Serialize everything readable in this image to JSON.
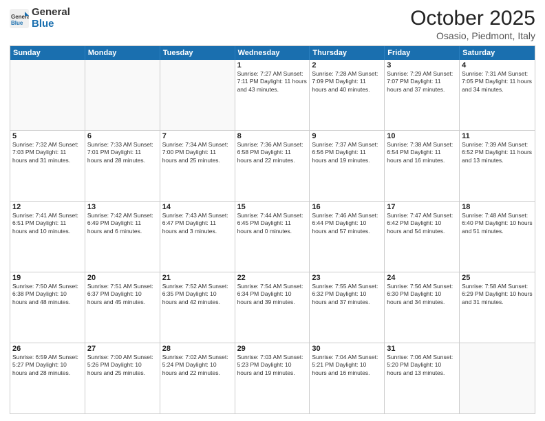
{
  "logo": {
    "general": "General",
    "blue": "Blue"
  },
  "header": {
    "month": "October 2025",
    "location": "Osasio, Piedmont, Italy"
  },
  "weekdays": [
    "Sunday",
    "Monday",
    "Tuesday",
    "Wednesday",
    "Thursday",
    "Friday",
    "Saturday"
  ],
  "rows": [
    [
      {
        "day": "",
        "info": ""
      },
      {
        "day": "",
        "info": ""
      },
      {
        "day": "",
        "info": ""
      },
      {
        "day": "1",
        "info": "Sunrise: 7:27 AM\nSunset: 7:11 PM\nDaylight: 11 hours\nand 43 minutes."
      },
      {
        "day": "2",
        "info": "Sunrise: 7:28 AM\nSunset: 7:09 PM\nDaylight: 11 hours\nand 40 minutes."
      },
      {
        "day": "3",
        "info": "Sunrise: 7:29 AM\nSunset: 7:07 PM\nDaylight: 11 hours\nand 37 minutes."
      },
      {
        "day": "4",
        "info": "Sunrise: 7:31 AM\nSunset: 7:05 PM\nDaylight: 11 hours\nand 34 minutes."
      }
    ],
    [
      {
        "day": "5",
        "info": "Sunrise: 7:32 AM\nSunset: 7:03 PM\nDaylight: 11 hours\nand 31 minutes."
      },
      {
        "day": "6",
        "info": "Sunrise: 7:33 AM\nSunset: 7:01 PM\nDaylight: 11 hours\nand 28 minutes."
      },
      {
        "day": "7",
        "info": "Sunrise: 7:34 AM\nSunset: 7:00 PM\nDaylight: 11 hours\nand 25 minutes."
      },
      {
        "day": "8",
        "info": "Sunrise: 7:36 AM\nSunset: 6:58 PM\nDaylight: 11 hours\nand 22 minutes."
      },
      {
        "day": "9",
        "info": "Sunrise: 7:37 AM\nSunset: 6:56 PM\nDaylight: 11 hours\nand 19 minutes."
      },
      {
        "day": "10",
        "info": "Sunrise: 7:38 AM\nSunset: 6:54 PM\nDaylight: 11 hours\nand 16 minutes."
      },
      {
        "day": "11",
        "info": "Sunrise: 7:39 AM\nSunset: 6:52 PM\nDaylight: 11 hours\nand 13 minutes."
      }
    ],
    [
      {
        "day": "12",
        "info": "Sunrise: 7:41 AM\nSunset: 6:51 PM\nDaylight: 11 hours\nand 10 minutes."
      },
      {
        "day": "13",
        "info": "Sunrise: 7:42 AM\nSunset: 6:49 PM\nDaylight: 11 hours\nand 6 minutes."
      },
      {
        "day": "14",
        "info": "Sunrise: 7:43 AM\nSunset: 6:47 PM\nDaylight: 11 hours\nand 3 minutes."
      },
      {
        "day": "15",
        "info": "Sunrise: 7:44 AM\nSunset: 6:45 PM\nDaylight: 11 hours\nand 0 minutes."
      },
      {
        "day": "16",
        "info": "Sunrise: 7:46 AM\nSunset: 6:44 PM\nDaylight: 10 hours\nand 57 minutes."
      },
      {
        "day": "17",
        "info": "Sunrise: 7:47 AM\nSunset: 6:42 PM\nDaylight: 10 hours\nand 54 minutes."
      },
      {
        "day": "18",
        "info": "Sunrise: 7:48 AM\nSunset: 6:40 PM\nDaylight: 10 hours\nand 51 minutes."
      }
    ],
    [
      {
        "day": "19",
        "info": "Sunrise: 7:50 AM\nSunset: 6:38 PM\nDaylight: 10 hours\nand 48 minutes."
      },
      {
        "day": "20",
        "info": "Sunrise: 7:51 AM\nSunset: 6:37 PM\nDaylight: 10 hours\nand 45 minutes."
      },
      {
        "day": "21",
        "info": "Sunrise: 7:52 AM\nSunset: 6:35 PM\nDaylight: 10 hours\nand 42 minutes."
      },
      {
        "day": "22",
        "info": "Sunrise: 7:54 AM\nSunset: 6:34 PM\nDaylight: 10 hours\nand 39 minutes."
      },
      {
        "day": "23",
        "info": "Sunrise: 7:55 AM\nSunset: 6:32 PM\nDaylight: 10 hours\nand 37 minutes."
      },
      {
        "day": "24",
        "info": "Sunrise: 7:56 AM\nSunset: 6:30 PM\nDaylight: 10 hours\nand 34 minutes."
      },
      {
        "day": "25",
        "info": "Sunrise: 7:58 AM\nSunset: 6:29 PM\nDaylight: 10 hours\nand 31 minutes."
      }
    ],
    [
      {
        "day": "26",
        "info": "Sunrise: 6:59 AM\nSunset: 5:27 PM\nDaylight: 10 hours\nand 28 minutes."
      },
      {
        "day": "27",
        "info": "Sunrise: 7:00 AM\nSunset: 5:26 PM\nDaylight: 10 hours\nand 25 minutes."
      },
      {
        "day": "28",
        "info": "Sunrise: 7:02 AM\nSunset: 5:24 PM\nDaylight: 10 hours\nand 22 minutes."
      },
      {
        "day": "29",
        "info": "Sunrise: 7:03 AM\nSunset: 5:23 PM\nDaylight: 10 hours\nand 19 minutes."
      },
      {
        "day": "30",
        "info": "Sunrise: 7:04 AM\nSunset: 5:21 PM\nDaylight: 10 hours\nand 16 minutes."
      },
      {
        "day": "31",
        "info": "Sunrise: 7:06 AM\nSunset: 5:20 PM\nDaylight: 10 hours\nand 13 minutes."
      },
      {
        "day": "",
        "info": ""
      }
    ]
  ]
}
